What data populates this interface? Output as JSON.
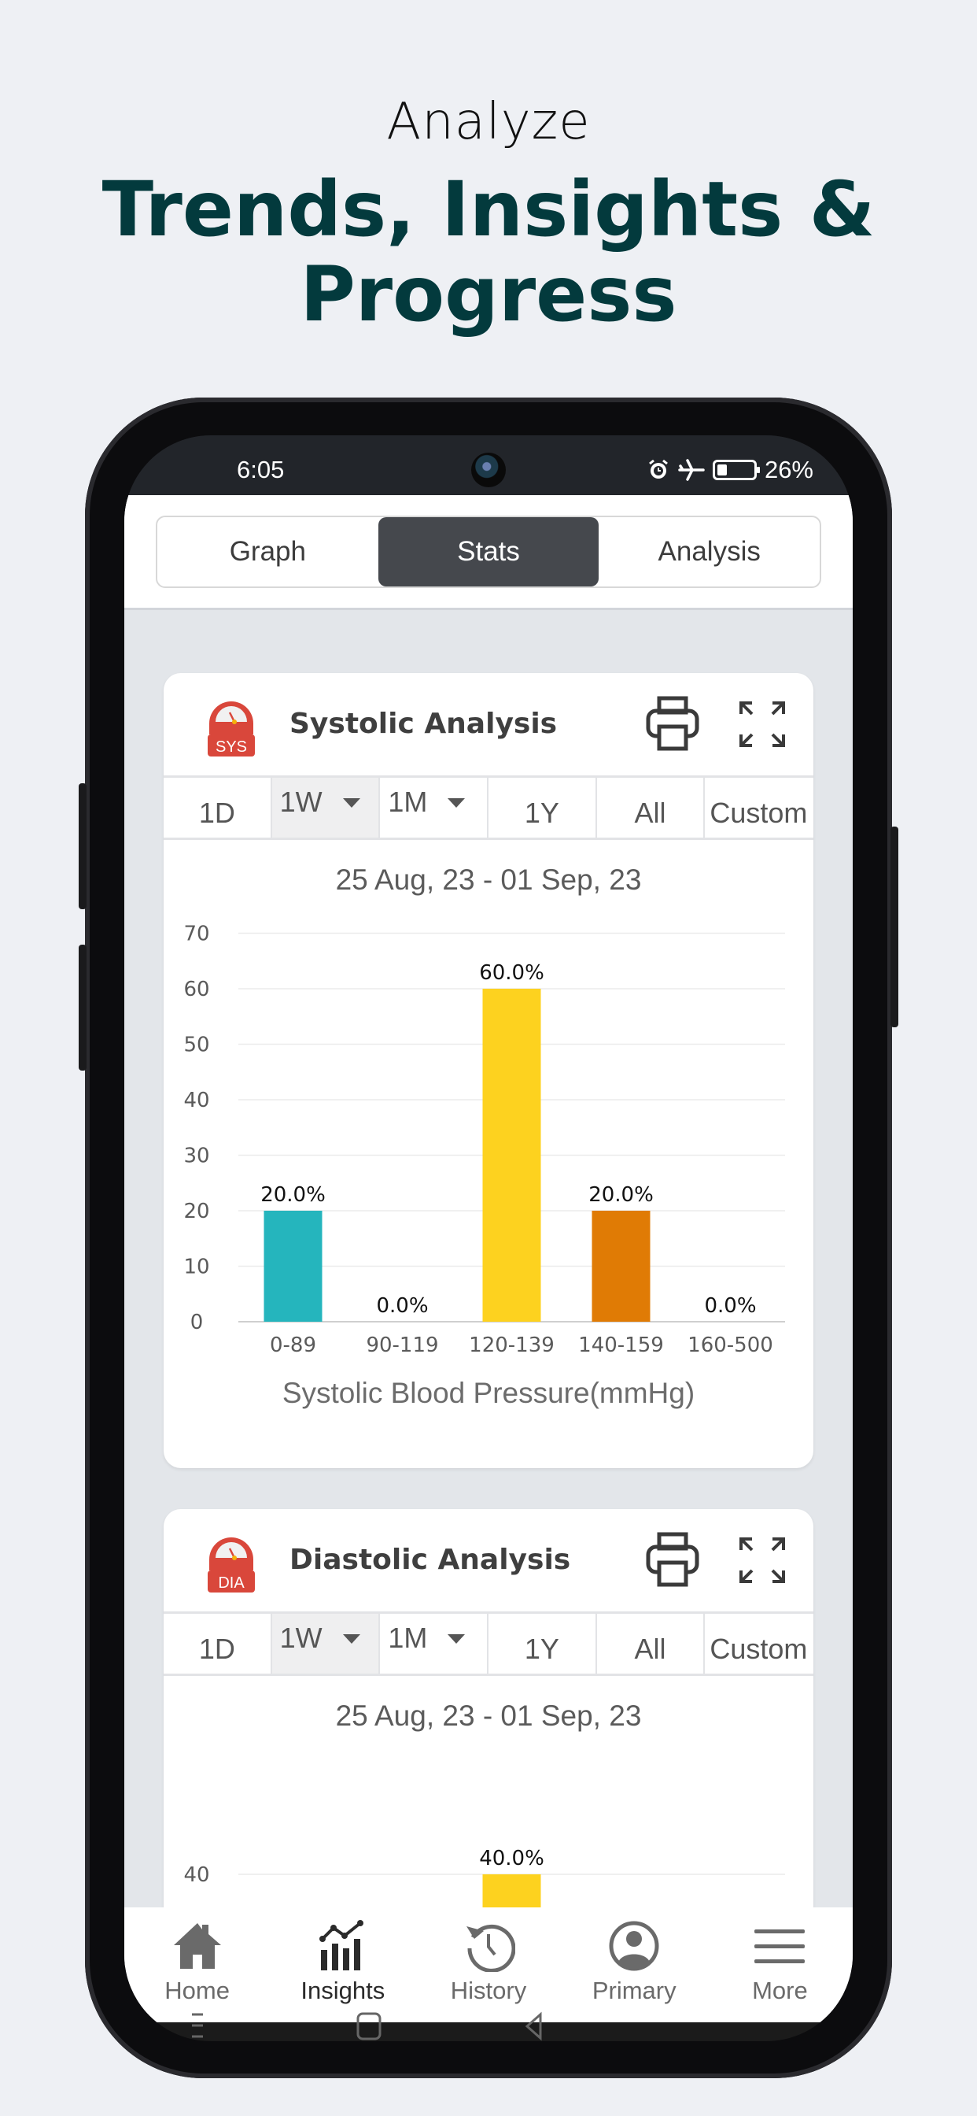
{
  "hero": {
    "subtitle": "Analyze",
    "title_line1": "Trends, Insights &",
    "title_line2": "Progress"
  },
  "status_bar": {
    "time": "6:05",
    "icons": [
      "alarm-icon",
      "airplane-mode-icon",
      "battery-icon"
    ],
    "battery": "26%"
  },
  "segments": [
    {
      "label": "Graph",
      "active": false
    },
    {
      "label": "Stats",
      "active": true
    },
    {
      "label": "Analysis",
      "active": false
    }
  ],
  "range_options": [
    {
      "label": "1D"
    },
    {
      "label": "1W",
      "dropdown": true,
      "selected": true
    },
    {
      "label": "1M",
      "dropdown": true
    },
    {
      "label": "1Y"
    },
    {
      "label": "All"
    },
    {
      "label": "Custom"
    }
  ],
  "cards": [
    {
      "badge": "SYS",
      "title": "Systolic Analysis",
      "date_range": "25 Aug, 23 - 01 Sep, 23"
    },
    {
      "badge": "DIA",
      "title": "Diastolic Analysis",
      "date_range": "25 Aug, 23 - 01 Sep, 23"
    }
  ],
  "colors": {
    "teal": "#25b5bd",
    "yellow": "#fdd21f",
    "orange": "#e07b05",
    "badge_red": "#d9473b",
    "title_dark": "#033a3d"
  },
  "chart_data": [
    {
      "type": "bar",
      "title": "25 Aug, 23 - 01 Sep, 23",
      "xlabel": "Systolic Blood Pressure(mmHg)",
      "ylabel": "",
      "categories": [
        "0-89",
        "90-119",
        "120-139",
        "140-159",
        "160-500"
      ],
      "values": [
        20,
        0,
        60,
        20,
        0
      ],
      "data_labels": [
        "20.0%",
        "0.0%",
        "60.0%",
        "20.0%",
        "0.0%"
      ],
      "bar_colors": [
        "#25b5bd",
        "#25b5bd",
        "#fdd21f",
        "#e07b05",
        "#d9473b"
      ],
      "yticks": [
        0,
        10,
        20,
        30,
        40,
        50,
        60,
        70
      ],
      "ylim": [
        0,
        70
      ],
      "grid": true
    },
    {
      "type": "bar",
      "title": "25 Aug, 23 - 01 Sep, 23",
      "xlabel": "",
      "categories": [
        "",
        "",
        "",
        "",
        ""
      ],
      "values": [
        null,
        null,
        40,
        null,
        null
      ],
      "data_labels": [
        "",
        "",
        "40.0%",
        "",
        ""
      ],
      "bar_colors": [
        "#25b5bd",
        "#25b5bd",
        "#fdd21f",
        "#e07b05",
        "#d9473b"
      ],
      "yticks_visible": [
        40
      ],
      "grid": true,
      "note": "partially visible, cut off by bottom navigation"
    }
  ],
  "tabbar": [
    {
      "label": "Home",
      "icon": "home-icon",
      "active": false
    },
    {
      "label": "Insights",
      "icon": "insights-icon",
      "active": true
    },
    {
      "label": "History",
      "icon": "history-icon",
      "active": false
    },
    {
      "label": "Primary",
      "icon": "profile-icon",
      "active": false
    },
    {
      "label": "More",
      "icon": "menu-icon",
      "active": false
    }
  ]
}
